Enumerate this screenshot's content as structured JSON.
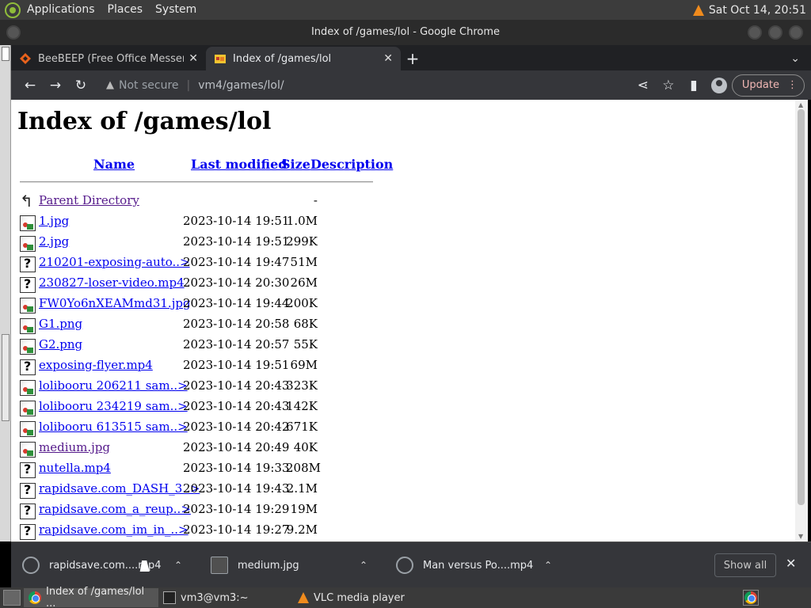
{
  "top_panel": {
    "menus": [
      "Applications",
      "Places",
      "System"
    ],
    "clock": "Sat Oct 14, 20:51"
  },
  "window": {
    "title": "Index of /games/lol - Google Chrome"
  },
  "tabs": [
    {
      "label": "BeeBEEP (Free Office Messenger)",
      "active": false
    },
    {
      "label": "Index of /games/lol",
      "active": true
    }
  ],
  "toolbar": {
    "security_label": "Not secure",
    "url": "vm4/games/lol/",
    "update_label": "Update"
  },
  "page": {
    "heading": "Index of /games/lol",
    "columns": [
      "Name",
      "Last modified",
      "Size",
      "Description"
    ],
    "parent": {
      "name": "Parent Directory",
      "size": "-"
    },
    "files": [
      {
        "name": "1.jpg",
        "modified": "2023-10-14 19:51",
        "size": "1.0M",
        "type": "image",
        "visited": false
      },
      {
        "name": "2.jpg",
        "modified": "2023-10-14 19:51",
        "size": "299K",
        "type": "image",
        "visited": false
      },
      {
        "name": "210201-exposing-auto..>",
        "modified": "2023-10-14 19:47",
        "size": "51M",
        "type": "unknown",
        "visited": false
      },
      {
        "name": "230827-loser-video.mp4",
        "modified": "2023-10-14 20:30",
        "size": "26M",
        "type": "unknown",
        "visited": false
      },
      {
        "name": "FW0Yo6nXEAMmd31.jpg",
        "modified": "2023-10-14 19:44",
        "size": "200K",
        "type": "image",
        "visited": false
      },
      {
        "name": "G1.png",
        "modified": "2023-10-14 20:58",
        "size": "68K",
        "type": "image",
        "visited": false
      },
      {
        "name": "G2.png",
        "modified": "2023-10-14 20:57",
        "size": "55K",
        "type": "image",
        "visited": false
      },
      {
        "name": "exposing-flyer.mp4",
        "modified": "2023-10-14 19:51",
        "size": "69M",
        "type": "unknown",
        "visited": false
      },
      {
        "name": "lolibooru 206211 sam..>",
        "modified": "2023-10-14 20:43",
        "size": "323K",
        "type": "image",
        "visited": false
      },
      {
        "name": "lolibooru 234219 sam..>",
        "modified": "2023-10-14 20:43",
        "size": "142K",
        "type": "image",
        "visited": false
      },
      {
        "name": "lolibooru 613515 sam..>",
        "modified": "2023-10-14 20:42",
        "size": "671K",
        "type": "image",
        "visited": false
      },
      {
        "name": "medium.jpg",
        "modified": "2023-10-14 20:49",
        "size": "40K",
        "type": "image",
        "visited": true
      },
      {
        "name": "nutella.mp4",
        "modified": "2023-10-14 19:33",
        "size": "208M",
        "type": "unknown",
        "visited": false
      },
      {
        "name": "rapidsave.com_DASH_3..>",
        "modified": "2023-10-14 19:43",
        "size": "2.1M",
        "type": "unknown",
        "visited": false
      },
      {
        "name": "rapidsave.com_a_reup..>",
        "modified": "2023-10-14 19:29",
        "size": "19M",
        "type": "unknown",
        "visited": false
      },
      {
        "name": "rapidsave.com_im_in_..>",
        "modified": "2023-10-14 19:27",
        "size": "9.2M",
        "type": "unknown",
        "visited": false
      }
    ]
  },
  "downloads": {
    "items": [
      {
        "name": "rapidsave.com....mp4"
      },
      {
        "name": "medium.jpg"
      },
      {
        "name": "Man versus Po....mp4"
      }
    ],
    "show_all_label": "Show all"
  },
  "taskbar": {
    "tasks": [
      {
        "label": "Index of /games/lol ...",
        "active": true
      },
      {
        "label": "vm3@vm3:~",
        "active": false
      },
      {
        "label": "VLC media player",
        "active": false
      }
    ]
  }
}
